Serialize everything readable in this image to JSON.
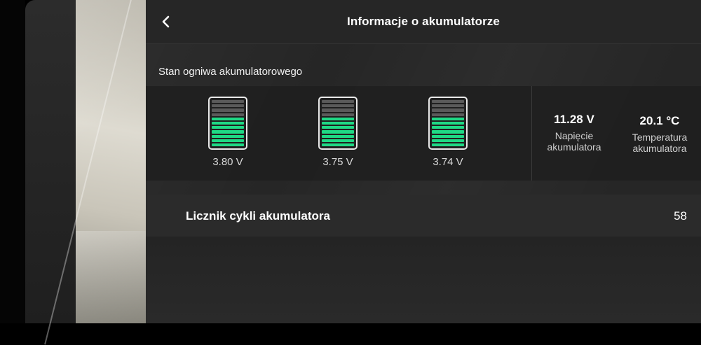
{
  "header": {
    "title": "Informacje o akumulatorze",
    "back_icon": "chevron-left-icon"
  },
  "cells_section": {
    "label": "Stan ogniwa akumulatorowego",
    "cells": [
      {
        "voltage": "3.80 V",
        "filled_segments": 7,
        "total_segments": 11
      },
      {
        "voltage": "3.75 V",
        "filled_segments": 7,
        "total_segments": 11
      },
      {
        "voltage": "3.74 V",
        "filled_segments": 7,
        "total_segments": 11
      }
    ]
  },
  "stats": {
    "voltage": {
      "value": "11.28 V",
      "label": "Napięcie akumulatora"
    },
    "temperature": {
      "value": "20.1 °C",
      "label": "Temperatura akumulatora"
    }
  },
  "cycle_counter": {
    "label": "Licznik cykli akumulatora",
    "value": "58"
  },
  "colors": {
    "cell_fill": "#1fd985",
    "cell_empty": "#5a5a5a",
    "panel_bg": "#262626"
  }
}
